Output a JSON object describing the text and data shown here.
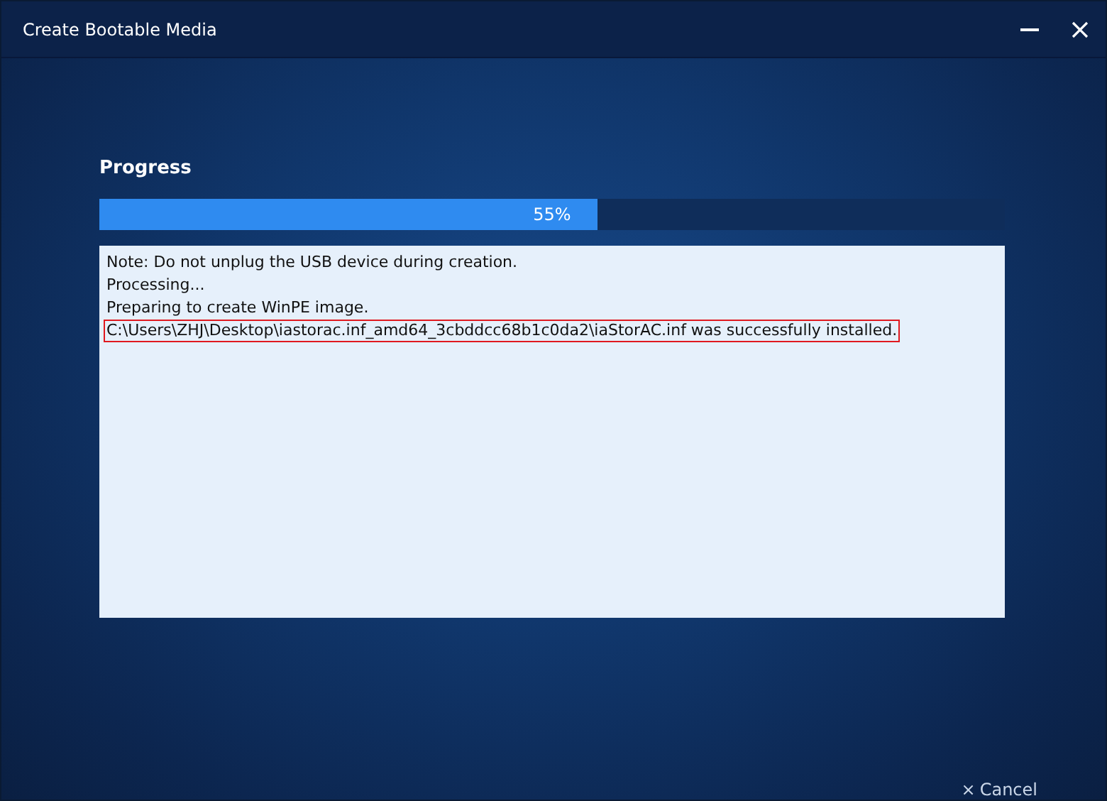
{
  "window": {
    "title": "Create Bootable Media"
  },
  "progress": {
    "title": "Progress",
    "level": 0.55,
    "reading": "55%"
  },
  "log": [
    {
      "text": "Note: Do not unplug the USB device during creation.",
      "highlighted": false
    },
    {
      "text": "Processing...",
      "highlighted": false
    },
    {
      "text": "Preparing to create WinPE image.",
      "highlighted": false
    },
    {
      "text": "C:\\Users\\ZHJ\\Desktop\\iastorac.inf_amd64_3cbddcc68b1c0da2\\iaStorAC.inf was successfully installed.",
      "highlighted": true
    }
  ],
  "cancel": {
    "icon": "×",
    "label": "Cancel"
  }
}
